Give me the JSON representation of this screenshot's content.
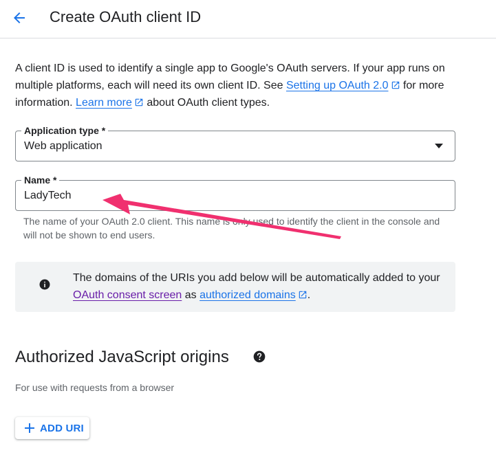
{
  "header": {
    "title": "Create OAuth client ID",
    "back_icon": "arrow-back-icon"
  },
  "intro": {
    "text_1": "A client ID is used to identify a single app to Google's OAuth servers. If your app runs on multiple platforms, each will need its own client ID. See ",
    "link_setup": "Setting up OAuth 2.0",
    "text_2": " for more information. ",
    "link_learn": "Learn more",
    "text_3": " about OAuth client types."
  },
  "application_type": {
    "label": "Application type *",
    "value": "Web application"
  },
  "name_field": {
    "label": "Name *",
    "value": "LadyTech",
    "helper": "The name of your OAuth 2.0 client. This name is only used to identify the client in the console and will not be shown to end users."
  },
  "banner": {
    "icon": "info-icon",
    "text_1": "The domains of the URIs you add below will be automatically added to your ",
    "link_consent": "OAuth consent screen",
    "text_2": " as ",
    "link_domains": "authorized domains",
    "text_3": "."
  },
  "js_origins": {
    "title": "Authorized JavaScript origins",
    "subtitle": "For use with requests from a browser",
    "help_icon": "help-icon",
    "add_button": "ADD URI"
  },
  "colors": {
    "link": "#1a73e8",
    "visited_link": "#681da8",
    "annotation_arrow": "#f0306f",
    "banner_bg": "#f1f3f4"
  }
}
